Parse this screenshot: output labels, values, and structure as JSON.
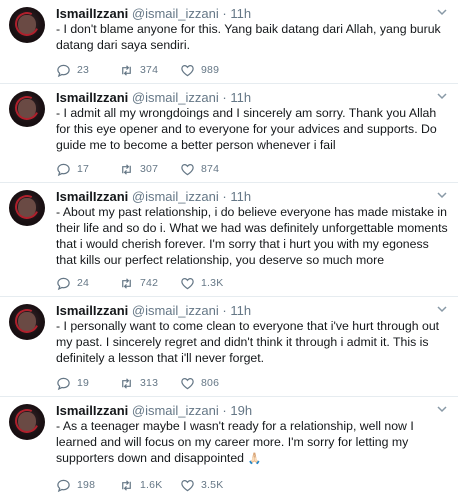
{
  "tweets": [
    {
      "name": "IsmailIzzani",
      "handle": "@ismail_izzani",
      "sep": "·",
      "time": "11h",
      "text": "- I don't blame anyone for this. Yang baik datang dari Allah, yang buruk datang dari saya sendiri.",
      "replies": "23",
      "retweets": "374",
      "likes": "989"
    },
    {
      "name": "IsmailIzzani",
      "handle": "@ismail_izzani",
      "sep": "·",
      "time": "11h",
      "text": "- I admit all my wrongdoings and I sincerely am sorry. Thank you Allah for this eye opener and to everyone for your advices and supports. Do guide me to become a better person whenever i fail",
      "replies": "17",
      "retweets": "307",
      "likes": "874"
    },
    {
      "name": "IsmailIzzani",
      "handle": "@ismail_izzani",
      "sep": "·",
      "time": "11h",
      "text": "- About my past relationship, i do believe everyone has made mistake in their life and so do i. What we had was definitely unforgettable moments that i would cherish forever. I'm sorry that i hurt you with my egoness that kills our perfect relationship, you deserve so much more",
      "replies": "24",
      "retweets": "742",
      "likes": "1.3K"
    },
    {
      "name": "IsmailIzzani",
      "handle": "@ismail_izzani",
      "sep": "·",
      "time": "11h",
      "text": "- I personally want to come clean to everyone that i've hurt through out my past. I sincerely regret and didn't think it through i admit it. This is definitely a lesson that i'll never forget.",
      "replies": "19",
      "retweets": "313",
      "likes": "806"
    },
    {
      "name": "IsmailIzzani",
      "handle": "@ismail_izzani",
      "sep": "·",
      "time": "19h",
      "text": "- As a teenager maybe I wasn't ready for a relationship, well now I learned and will focus on my career more. I'm sorry for letting my supporters down and disappointed",
      "emoji": "🙏🏻",
      "replies": "198",
      "retweets": "1.6K",
      "likes": "3.5K"
    }
  ],
  "icons": {
    "reply": "reply-icon",
    "retweet": "retweet-icon",
    "like": "heart-icon",
    "menu": "chevron-down-icon"
  },
  "colors": {
    "name": "#14171a",
    "meta": "#657786",
    "divider": "#e6ecf0"
  }
}
